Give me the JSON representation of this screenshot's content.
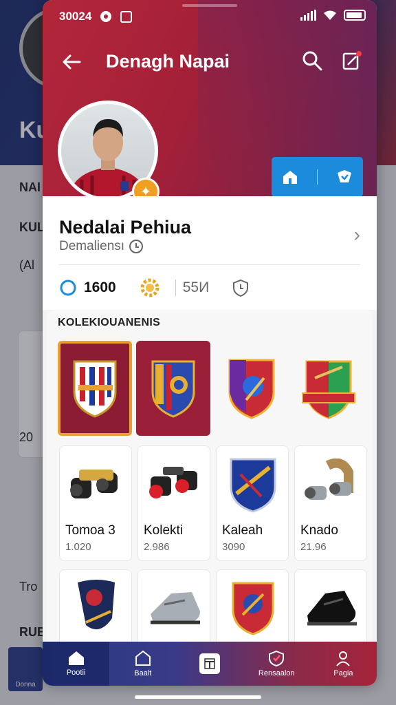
{
  "background_app": {
    "initials": "Ku",
    "lines": [
      "NAI",
      "KUL",
      "(Al",
      "20",
      "Tro",
      "RUB"
    ],
    "mini_badge": "Donna"
  },
  "status_bar": {
    "time": "30024"
  },
  "header": {
    "title": "Denagh Napai"
  },
  "profile": {
    "name": "Nedalai Pehiua",
    "subtitle": "Demaliensı",
    "coins": "1600",
    "stat_two": "55И"
  },
  "collection": {
    "heading": "KOLEKIOUANENIS",
    "items": [
      {
        "label": "Tomoa 3",
        "value": "1.020"
      },
      {
        "label": "Kolekti",
        "value": "2.986"
      },
      {
        "label": "Kaleah",
        "value": "3090"
      },
      {
        "label": "Knado",
        "value": "21.96"
      }
    ]
  },
  "nav": {
    "home": "Pootii",
    "second": "Baalt",
    "fourth": "Rensaalon",
    "fifth": "Pagia"
  },
  "colors": {
    "hero": "#a32038",
    "accent": "#1c8bdc",
    "nav_start": "#263a82",
    "nav_end": "#a5243a"
  }
}
